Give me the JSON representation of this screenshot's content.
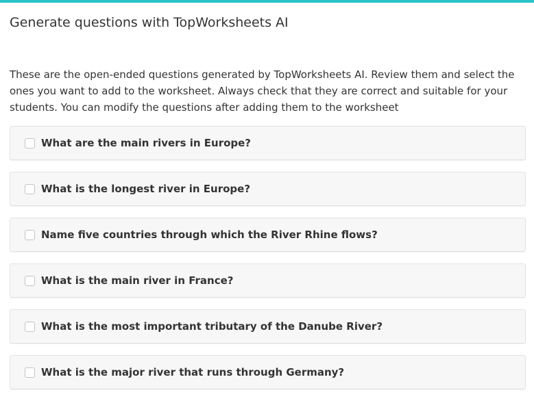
{
  "colors": {
    "accent": "#2bc4c6",
    "text": "#333333",
    "item_background": "#f7f7f7",
    "item_border": "#e2e2e2"
  },
  "modal": {
    "title": "Generate questions with TopWorksheets AI",
    "description": "These are the open-ended questions generated by TopWorksheets AI. Review them and select the ones you want to add to the worksheet. Always check that they are correct and suitable for your students. You can modify the questions after adding them to the worksheet"
  },
  "questions": [
    {
      "text": "What are the main rivers in Europe?",
      "checked": false
    },
    {
      "text": "What is the longest river in Europe?",
      "checked": false
    },
    {
      "text": "Name five countries through which the River Rhine flows?",
      "checked": false
    },
    {
      "text": "What is the main river in France?",
      "checked": false
    },
    {
      "text": "What is the most important tributary of the Danube River?",
      "checked": false
    },
    {
      "text": "What is the major river that runs through Germany?",
      "checked": false
    }
  ]
}
